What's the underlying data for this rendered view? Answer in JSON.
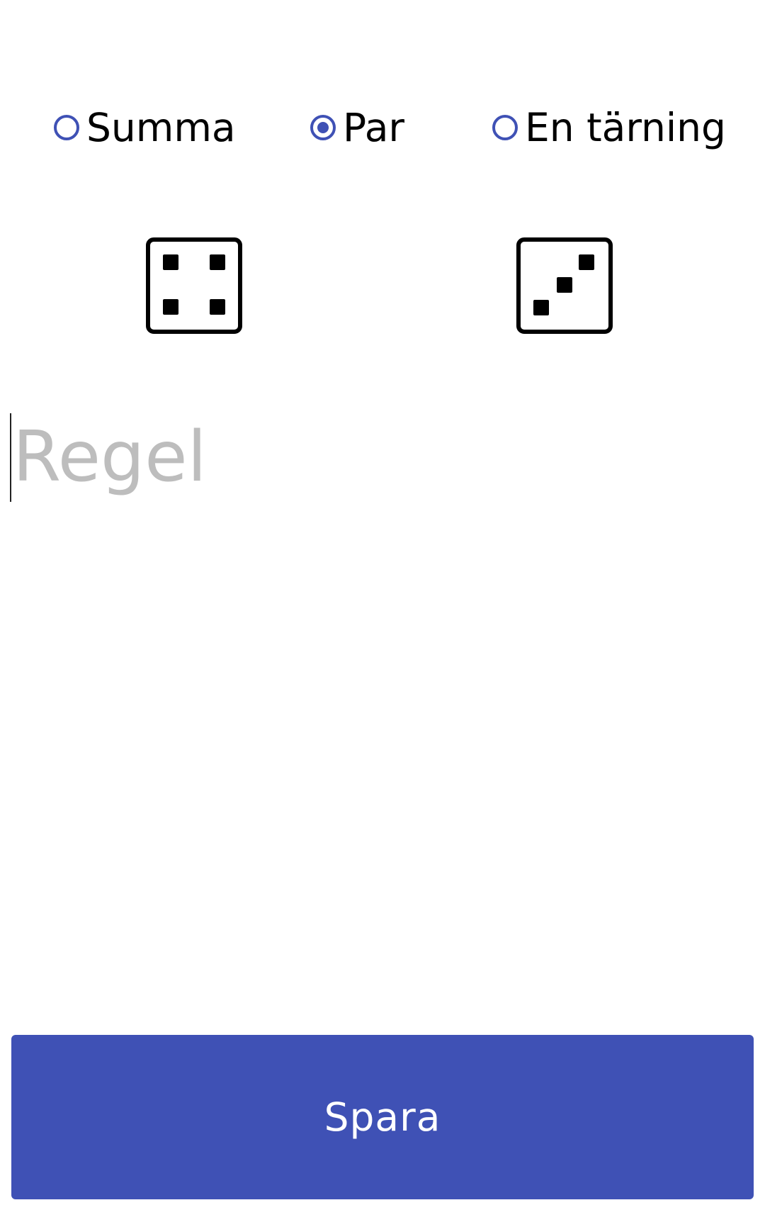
{
  "mode_selector": {
    "options": [
      {
        "label": "Summa",
        "checked": false
      },
      {
        "label": "Par",
        "checked": true
      },
      {
        "label": "En tärning",
        "checked": false
      }
    ]
  },
  "dice": [
    {
      "value": 4
    },
    {
      "value": 3
    }
  ],
  "rule_input": {
    "placeholder": "Regel",
    "value": ""
  },
  "save_button": {
    "label": "Spara"
  },
  "colors": {
    "accent": "#3f51b5",
    "placeholder": "#bdbdbd",
    "text": "#000000",
    "button_text": "#ffffff"
  }
}
